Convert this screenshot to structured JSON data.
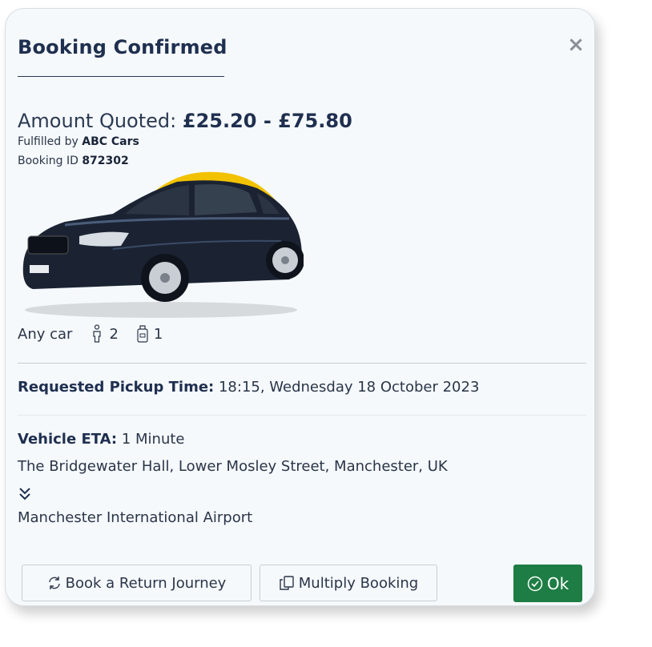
{
  "dialog": {
    "title": "Booking Confirmed",
    "close_symbol": "×"
  },
  "quote": {
    "label": "Amount Quoted:",
    "value": "£25.20 - £75.80",
    "fulfilled_label": "Fulfilled by",
    "fulfilled_value": "ABC Cars",
    "booking_id_label": "Booking ID",
    "booking_id_value": "872302"
  },
  "vehicle": {
    "type": "Any car",
    "passengers": "2",
    "luggage": "1",
    "image_icon": "taxi-car-image",
    "passenger_icon": "passenger-icon",
    "luggage_icon": "luggage-icon"
  },
  "pickup": {
    "label": "Requested Pickup Time:",
    "value": "18:15, Wednesday 18 October 2023"
  },
  "eta": {
    "label": "Vehicle ETA:",
    "value": "1 Minute"
  },
  "route": {
    "from": "The Bridgewater Hall, Lower Mosley Street, Manchester, UK",
    "to": "Manchester International Airport",
    "direction_icon": "double-chevron-down-icon"
  },
  "actions": {
    "return_label": "Book a Return Journey",
    "multiply_label": "Multiply Booking",
    "ok_label": "Ok"
  },
  "colors": {
    "ok_button": "#1e7d44",
    "title": "#1f2f4f",
    "background": "#f5f9fc",
    "taxi_roof_sign": "#f2c200"
  }
}
